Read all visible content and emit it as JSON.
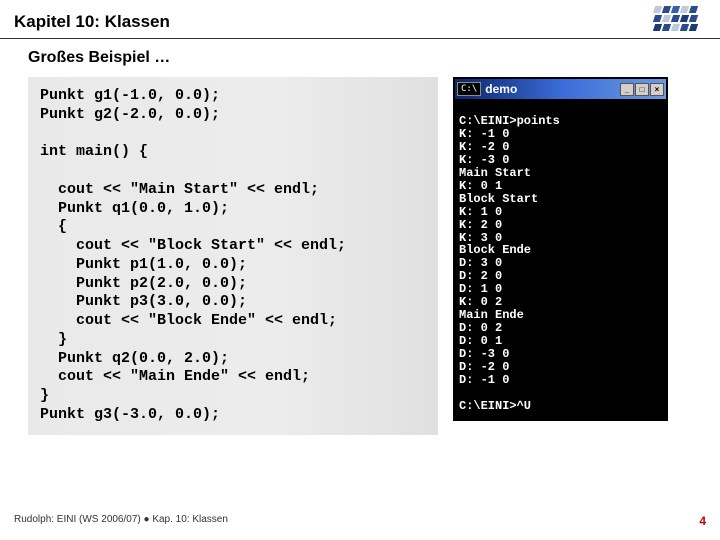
{
  "header": {
    "chapter": "Kapitel 10: Klassen"
  },
  "subtitle": "Großes Beispiel …",
  "code": "Punkt g1(-1.0, 0.0);\nPunkt g2(-2.0, 0.0);\n\nint main() {\n\n  cout << \"Main Start\" << endl;\n  Punkt q1(0.0, 1.0);\n  {\n    cout << \"Block Start\" << endl;\n    Punkt p1(1.0, 0.0);\n    Punkt p2(2.0, 0.0);\n    Punkt p3(3.0, 0.0);\n    cout << \"Block Ende\" << endl;\n  }\n  Punkt q2(0.0, 2.0);\n  cout << \"Main Ende\" << endl;\n}\nPunkt g3(-3.0, 0.0);",
  "console": {
    "title": "demo",
    "icon_label": "C:\\",
    "buttons": {
      "min": "_",
      "max": "□",
      "close": "×"
    },
    "output": "\nC:\\EINI>points\nK: -1 0\nK: -2 0\nK: -3 0\nMain Start\nK: 0 1\nBlock Start\nK: 1 0\nK: 2 0\nK: 3 0\nBlock Ende\nD: 3 0\nD: 2 0\nD: 1 0\nK: 0 2\nMain Ende\nD: 0 2\nD: 0 1\nD: -3 0\nD: -2 0\nD: -1 0\n\nC:\\EINI>^U"
  },
  "footer": {
    "left": "Rudolph: EINI (WS 2006/07) ● Kap. 10: Klassen",
    "page": "4"
  }
}
